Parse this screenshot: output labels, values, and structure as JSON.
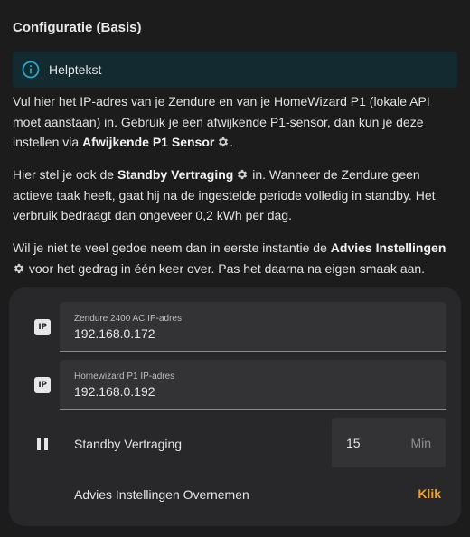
{
  "title": "Configuratie (Basis)",
  "help": {
    "label": "Helptekst",
    "icon": "info-circle-icon"
  },
  "paragraphs": {
    "p1_text": "Vul hier het IP-adres van je Zendure en van je HomeWizard P1 (lokale API moet aanstaan) in. Gebruik je een afwijkende P1-sensor, dan kun je deze instellen via ",
    "p1_bold": "Afwijkende P1 Sensor",
    "p1_end": ".",
    "p2_text": "Hier stel je ook de ",
    "p2_bold": "Standby Vertraging",
    "p2_end": " in. Wanneer de Zendure geen actieve taak heeft, gaat hij na de ingestelde periode volledig in standby. Het verbruik bedraagt dan ongeveer 0,2 kWh per dag.",
    "p3_text": "Wil je niet te veel gedoe neem dan in eerste instantie de ",
    "p3_bold": "Advies Instellingen",
    "p3_end": " voor het gedrag in één keer over. Pas het daarna na eigen smaak aan."
  },
  "fields": {
    "zendure": {
      "icon_text": "IP",
      "label": "Zendure 2400 AC IP-adres",
      "value": "192.168.0.172"
    },
    "homewizard": {
      "icon_text": "IP",
      "label": "Homewizard P1 IP-adres",
      "value": "192.168.0.192"
    }
  },
  "standby": {
    "label": "Standby Vertraging",
    "value": "15",
    "unit": "Min"
  },
  "advies": {
    "label": "Advies Instellingen Overnemen",
    "action": "Klik"
  },
  "colors": {
    "background": "#1c1c1c",
    "card": "#28282a",
    "help_bg": "#132a30",
    "accent": "#f0a02a",
    "info": "#2aa5c8"
  }
}
